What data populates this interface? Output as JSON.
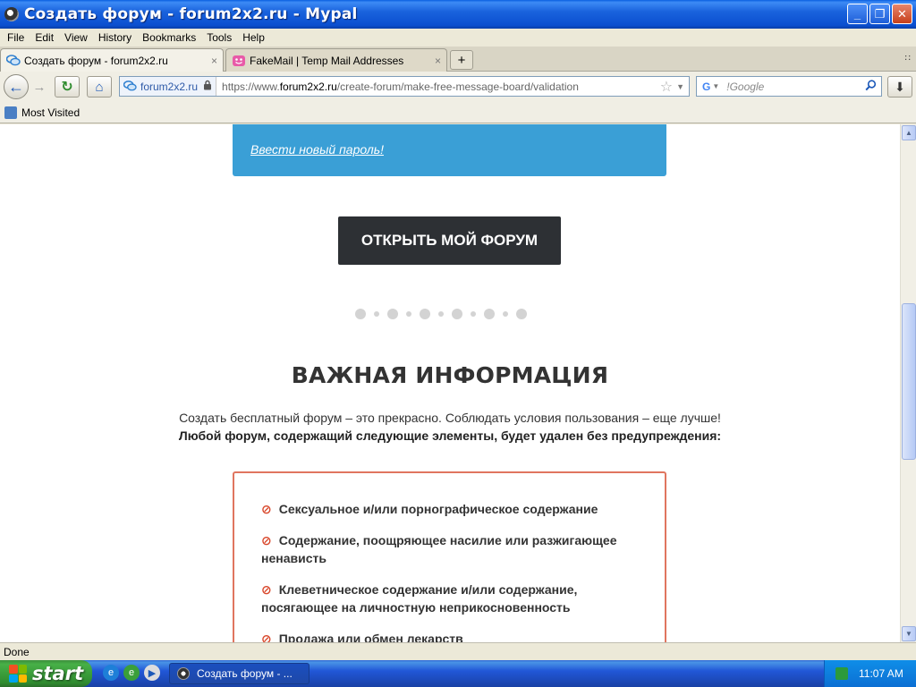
{
  "window": {
    "title": "Создать форум - forum2x2.ru - Mypal",
    "minimize": "_",
    "maximize": "❐",
    "close": "✕"
  },
  "menu": [
    "File",
    "Edit",
    "View",
    "History",
    "Bookmarks",
    "Tools",
    "Help"
  ],
  "tabs": [
    {
      "label": "Создать форум - forum2x2.ru",
      "close": "×",
      "icon": "chat-bubble-icon"
    },
    {
      "label": "FakeMail | Temp Mail Addresses",
      "close": "×",
      "icon": "pink-face-icon"
    }
  ],
  "new_tab": "+",
  "tab_list": "∷",
  "nav": {
    "back": "←",
    "forward": "→",
    "reload": "↻",
    "home": "⌂",
    "site_identity": "forum2x2.ru",
    "url_prefix": "https://www.",
    "url_domain": "forum2x2.ru",
    "url_path": "/create-forum/make-free-message-board/validation",
    "search_engine": "G",
    "search_placeholder": "!Google",
    "download": "⬇"
  },
  "bookmarks": {
    "most_visited": "Most Visited"
  },
  "page": {
    "new_password_link": "Ввести новый пароль!",
    "open_forum_button": "ОТКРЫТЬ МОЙ ФОРУМ",
    "important_heading": "ВАЖНАЯ ИНФОРМАЦИЯ",
    "intro_text": "Создать бесплатный форум – это прекрасно. Соблюдать условия пользования – еще лучше!",
    "warning_text": "Любой форум, содержащий следующие элементы, будет удален без предупреждения:",
    "ban_symbol": "⊘",
    "rules": [
      "Сексуальное и/или порнографическое содержание",
      "Содержание, поощряющее насилие или разжигающее ненависть",
      "Клеветническое содержание и/или содержание, посягающее на личностную неприкосновенность",
      "Продажа или обмен лекарств"
    ]
  },
  "status": {
    "text": "Done"
  },
  "taskbar": {
    "start": "start",
    "task_item": "Создать форум - ...",
    "clock": "11:07 AM"
  },
  "colors": {
    "blue_box": "#3a9fd6",
    "dark_button": "#2d3034",
    "rule_border": "#e0755f",
    "ban_icon": "#d9472b"
  }
}
